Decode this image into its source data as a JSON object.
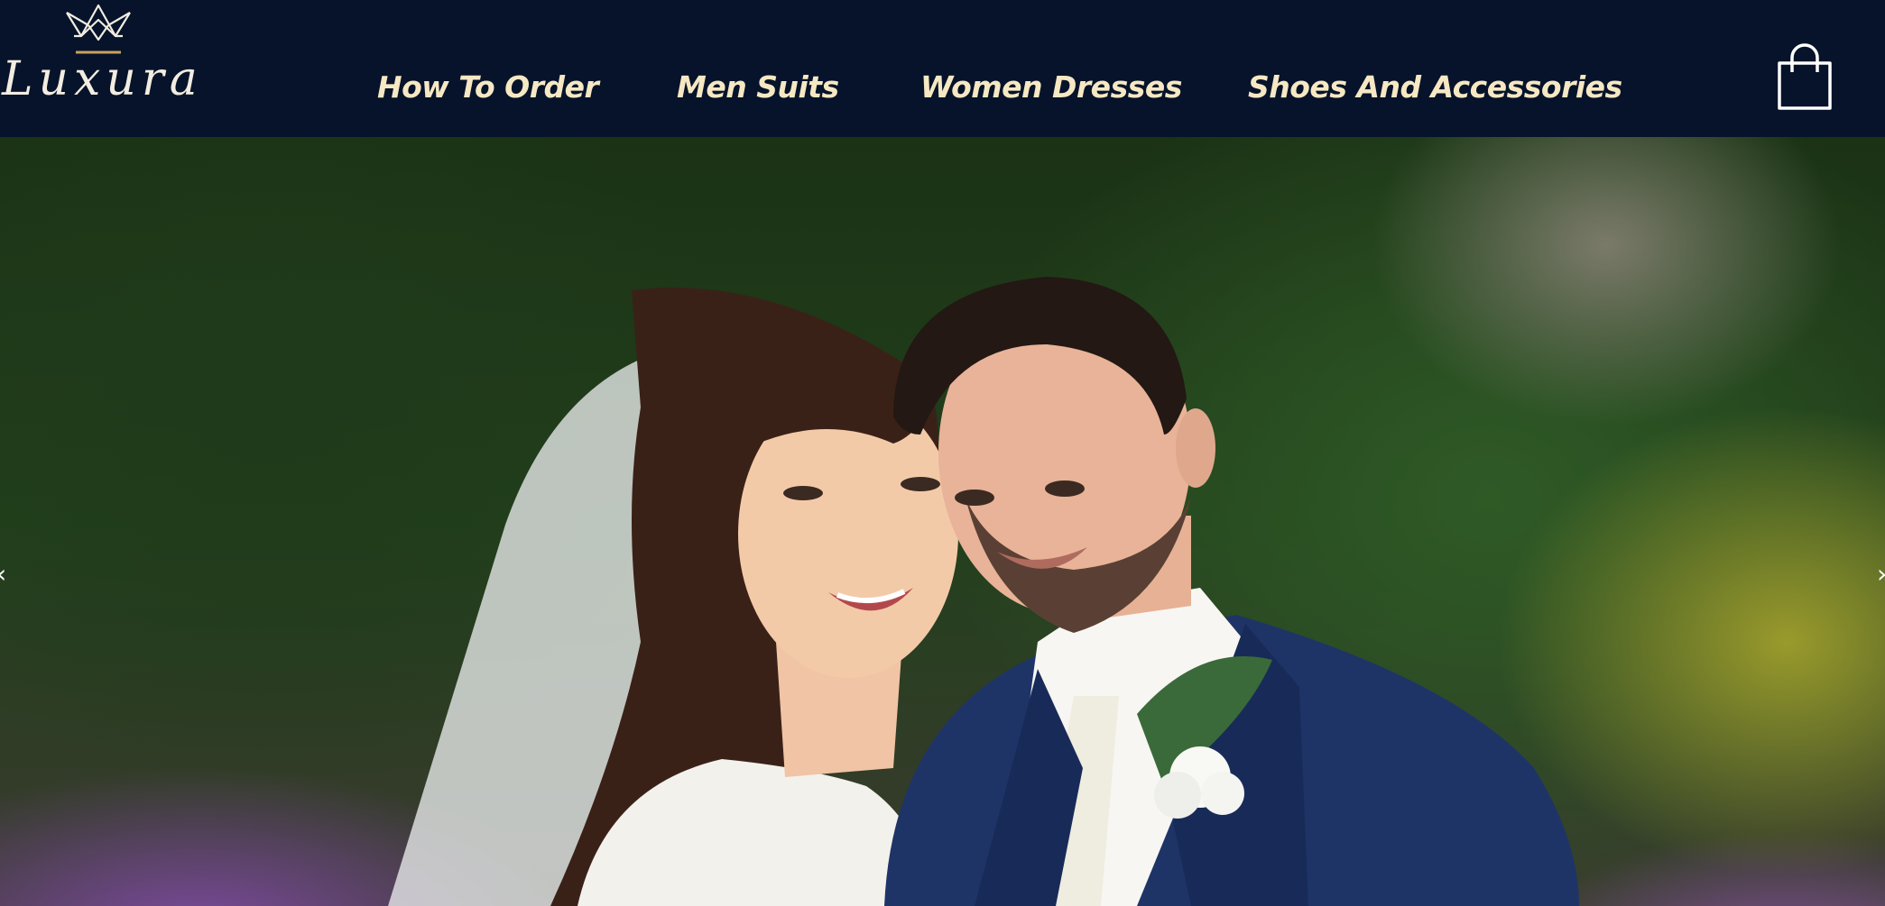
{
  "brand": {
    "name": "Luxura",
    "icon": "crown-logo-icon"
  },
  "nav": {
    "items": [
      {
        "label": "How To Order"
      },
      {
        "label": "Men Suits"
      },
      {
        "label": "Women Dresses"
      },
      {
        "label": "Shoes And Accessories"
      }
    ]
  },
  "cart": {
    "icon": "shopping-bag-icon"
  },
  "hero": {
    "prev_arrow": "‹",
    "next_arrow": "›"
  },
  "colors": {
    "header_bg": "#06132b",
    "nav_text": "#f6e8c3",
    "logo_accent": "#c9a25a"
  }
}
